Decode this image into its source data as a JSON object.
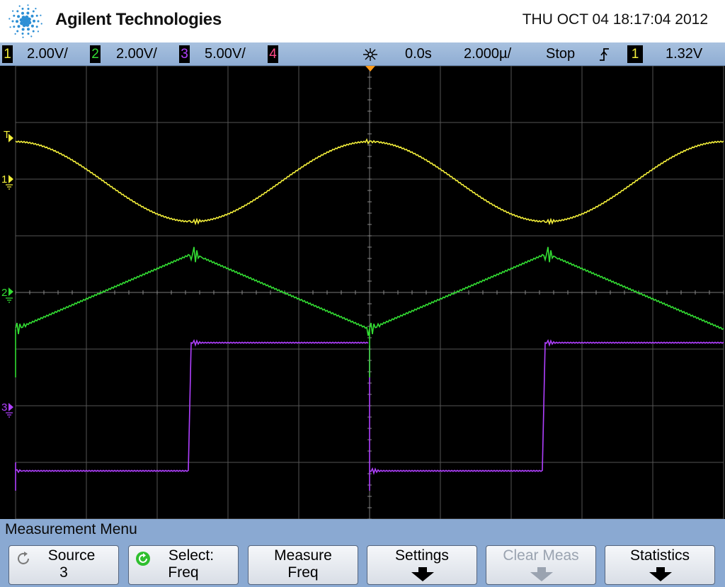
{
  "header": {
    "brand": "Agilent Technologies",
    "datetime": "THU OCT 04 18:17:04 2012"
  },
  "statusbar": {
    "ch1": {
      "num": "1",
      "scale": "2.00V/",
      "color": "#f2ee3a"
    },
    "ch2": {
      "num": "2",
      "scale": "2.00V/",
      "color": "#33dd33"
    },
    "ch3": {
      "num": "3",
      "scale": "5.00V/",
      "color": "#b040ff"
    },
    "ch4": {
      "num": "4",
      "color": "#ff4a8a"
    },
    "delay": "0.0s",
    "timebase": "2.000µ/",
    "run_state": "Stop",
    "trigger_slope_icon": "rising-edge-icon",
    "trigger_source": "1",
    "trigger_level": "1.32V"
  },
  "screen": {
    "markers": {
      "trigger": "T",
      "ch1": "1",
      "ch2": "2",
      "ch3": "3"
    }
  },
  "menu": {
    "title": "Measurement Menu",
    "softkeys": [
      {
        "line1": "Source",
        "line2": "3",
        "icon": "rotary-knob-icon"
      },
      {
        "line1": "Select:",
        "line2": "Freq",
        "icon": "rotary-knob-green-icon"
      },
      {
        "line1": "Measure",
        "line2": "Freq"
      },
      {
        "line1": "Settings",
        "icon": "submenu-arrow-icon"
      },
      {
        "line1": "Clear Meas",
        "icon": "submenu-arrow-icon",
        "disabled": true
      },
      {
        "line1": "Statistics",
        "icon": "submenu-arrow-icon"
      }
    ]
  }
}
